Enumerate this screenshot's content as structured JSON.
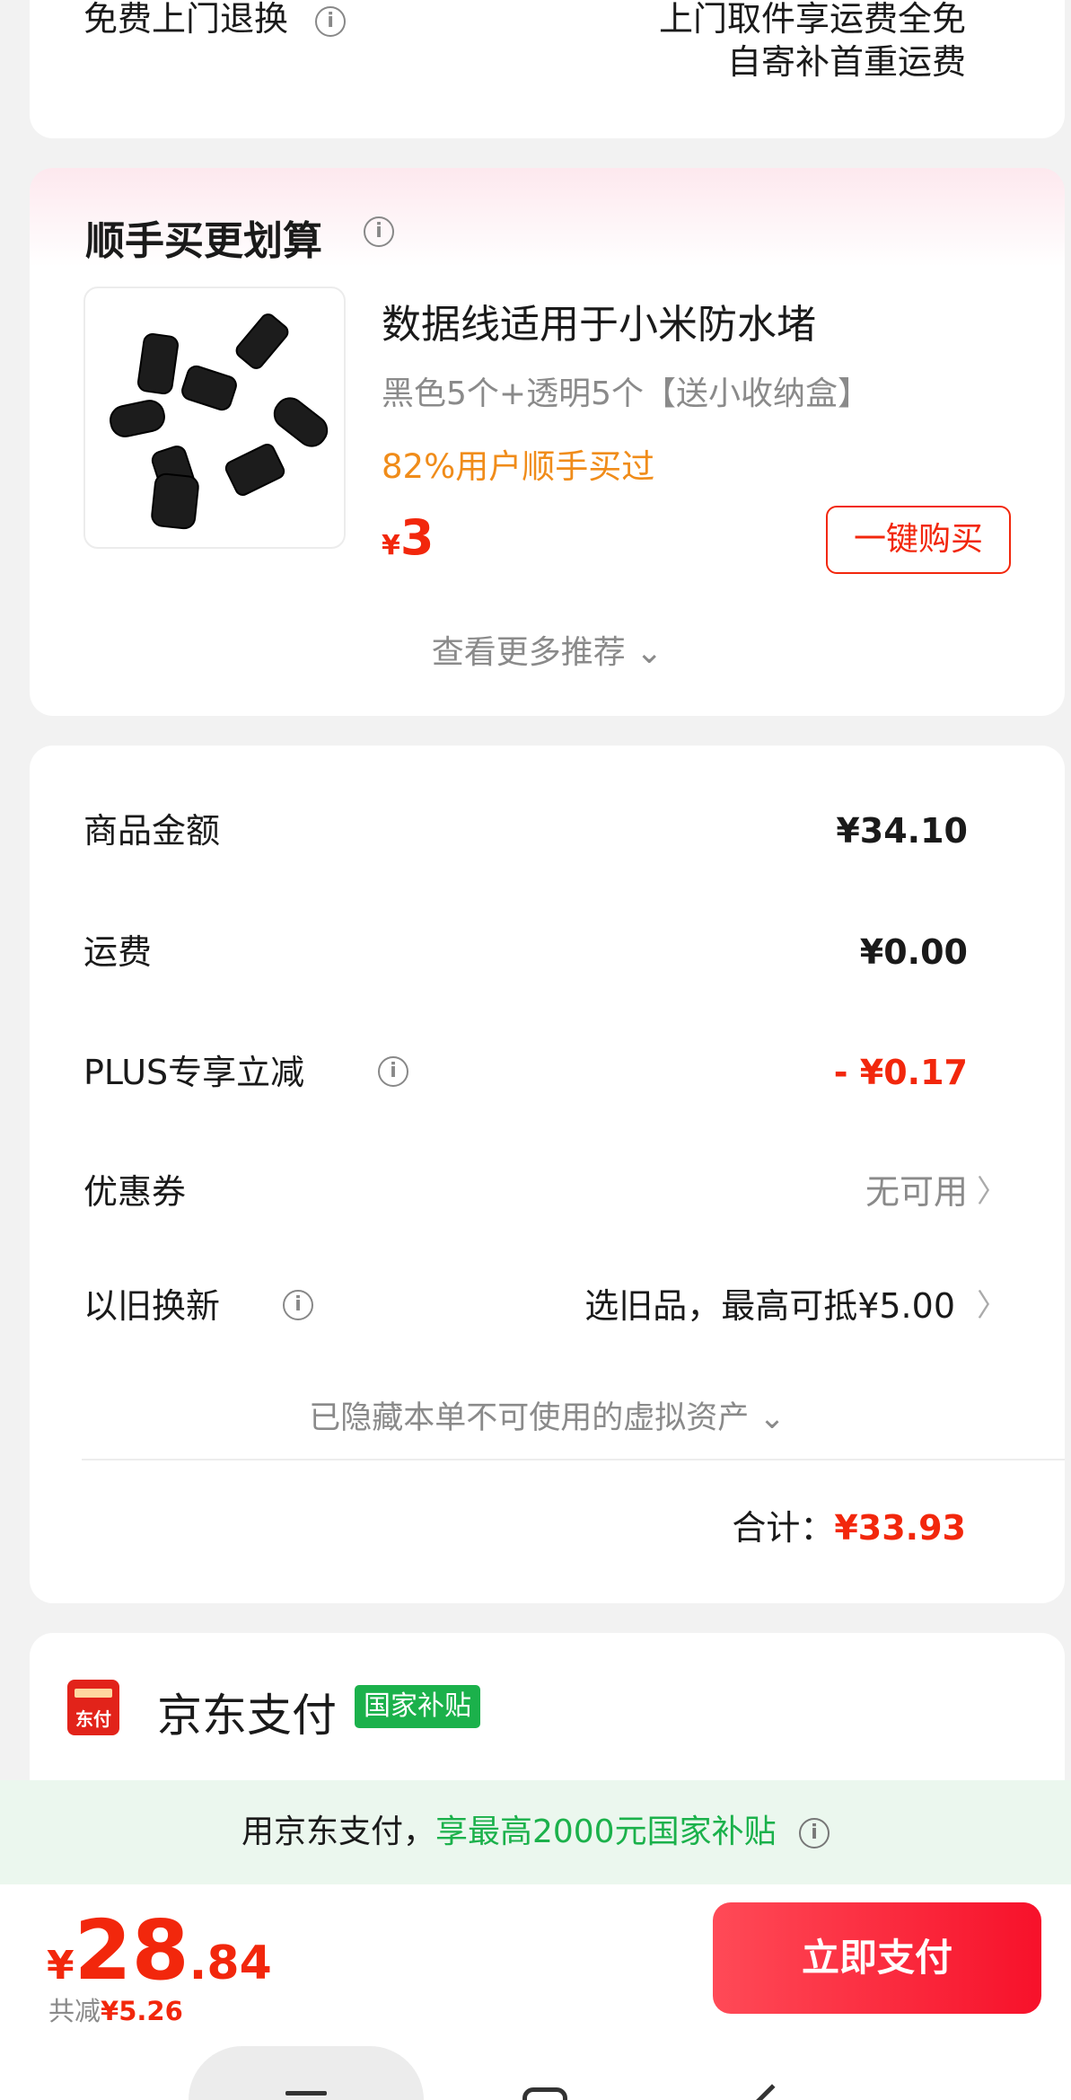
{
  "top_card": {
    "left_label": "免费上门退换",
    "right_line1": "上门取件享运费全免",
    "right_line2": "自寄补首重运费"
  },
  "recommend": {
    "title": "顺手买更划算",
    "product_name": "数据线适用于小米防水堵",
    "product_spec": "黑色5个+透明5个【送小收纳盒】",
    "product_stat": "82%用户顺手买过",
    "currency": "¥",
    "price": "3",
    "buy_label": "一键购买",
    "more_label": "查看更多推荐 ⌄",
    "thumb_icon": "rubber-plugs-image"
  },
  "price_details": {
    "rows": [
      {
        "label": "商品金额",
        "value": "¥34.10"
      },
      {
        "label": "运费",
        "value": "¥0.00"
      },
      {
        "label": "PLUS专享立减",
        "value": "- ¥0.17"
      },
      {
        "label": "优惠券",
        "value": "无可用"
      },
      {
        "label": "以旧换新",
        "value": "选旧品，最高可抵¥5.00"
      }
    ],
    "hidden_assets": "已隐藏本单不可使用的虚拟资产 ⌄",
    "total_label": "合计：",
    "total_value": "¥33.93"
  },
  "payment": {
    "icon_text": "东付",
    "name": "京东支付",
    "badge": "国家补贴"
  },
  "banner": {
    "prefix": "用京东支付，",
    "highlight": "享最高2000元国家补贴"
  },
  "bottom": {
    "currency": "¥",
    "price_int": "28",
    "price_dec": ".84",
    "saved_label": "共减",
    "saved_value": "¥5.26",
    "pay_label": "立即支付"
  },
  "colors": {
    "accent_red": "#f2270c",
    "accent_orange": "#f08c1a",
    "accent_green": "#1bb14b"
  }
}
